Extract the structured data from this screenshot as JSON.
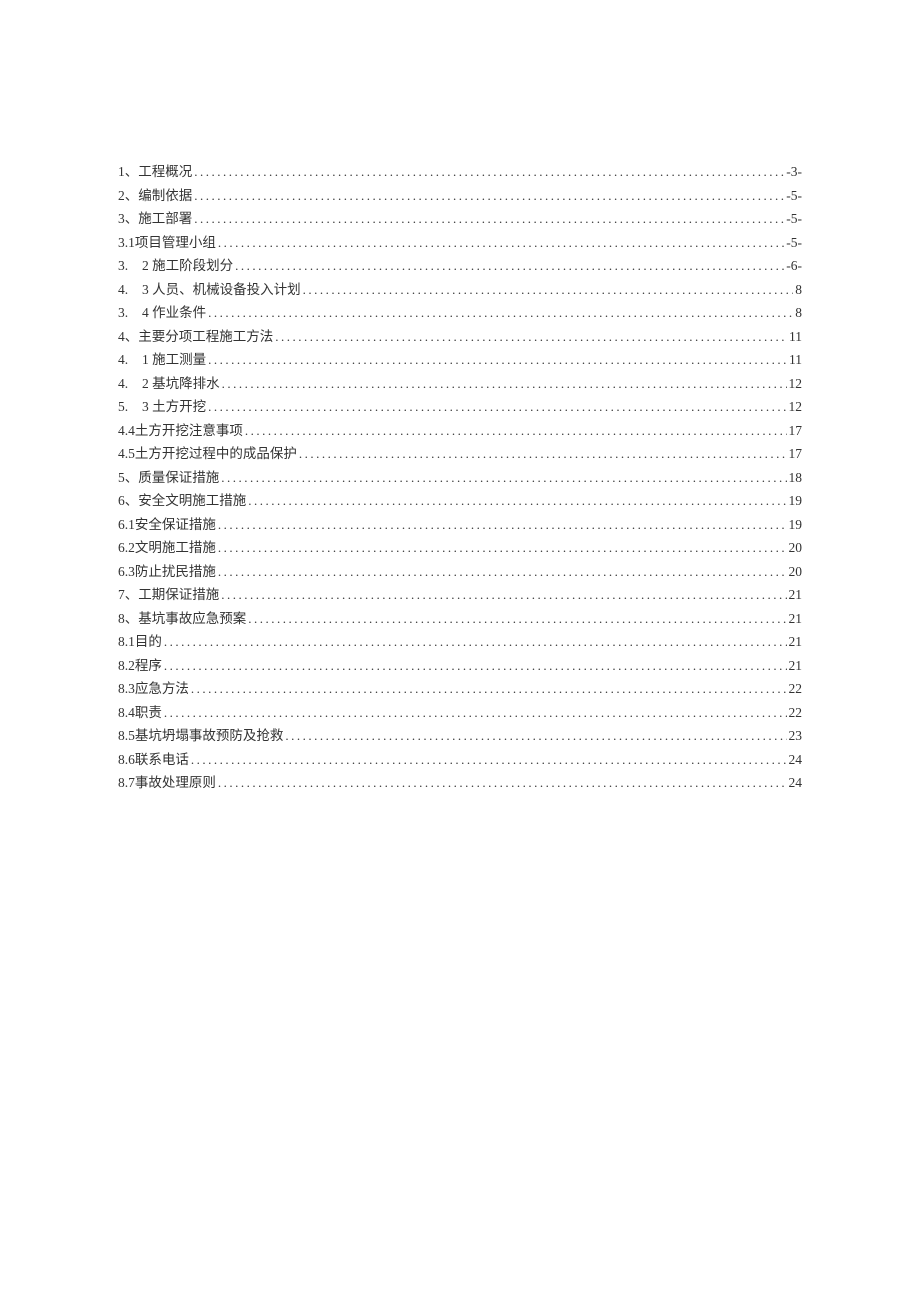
{
  "toc": [
    {
      "prefix": "1、",
      "title": "工程概况",
      "page": "-3-",
      "spaced": false
    },
    {
      "prefix": "2、",
      "title": "编制依据",
      "page": "-5-",
      "spaced": false
    },
    {
      "prefix": "3、",
      "title": "施工部署",
      "page": "-5-",
      "spaced": false
    },
    {
      "prefix": "3.1 ",
      "title": "项目管理小组",
      "page": "-5-",
      "spaced": false
    },
    {
      "prefix": "3.",
      "title": "2 施工阶段划分",
      "page": "-6-",
      "spaced": true
    },
    {
      "prefix": "4.",
      "title": "3 人员、机械设备投入计划",
      "page": "8",
      "spaced": true
    },
    {
      "prefix": "3.",
      "title": "4 作业条件",
      "page": "8",
      "spaced": true
    },
    {
      "prefix": "4、",
      "title": "主要分项工程施工方法",
      "page": "11",
      "spaced": false
    },
    {
      "prefix": "4.",
      "title": "1 施工测量",
      "page": "11",
      "spaced": true
    },
    {
      "prefix": "4.",
      "title": "2 基坑降排水",
      "page": "12",
      "spaced": true
    },
    {
      "prefix": "5.",
      "title": "3 土方开挖",
      "page": "12",
      "spaced": true
    },
    {
      "prefix": "4.4 ",
      "title": "土方开挖注意事项",
      "page": "17",
      "spaced": false
    },
    {
      "prefix": "4.5 ",
      "title": "土方开挖过程中的成品保护",
      "page": "17",
      "spaced": false
    },
    {
      "prefix": "5、",
      "title": "质量保证措施",
      "page": "18",
      "spaced": false
    },
    {
      "prefix": "6、",
      "title": "安全文明施工措施",
      "page": "19",
      "spaced": false
    },
    {
      "prefix": "6.1 ",
      "title": "安全保证措施",
      "page": "19",
      "spaced": false
    },
    {
      "prefix": "6.2 ",
      "title": "文明施工措施",
      "page": "20",
      "spaced": false
    },
    {
      "prefix": "6.3 ",
      "title": "防止扰民措施",
      "page": "20",
      "spaced": false
    },
    {
      "prefix": "7、",
      "title": "工期保证措施",
      "page": "21",
      "spaced": false
    },
    {
      "prefix": "8、",
      "title": "基坑事故应急预案",
      "page": "21",
      "spaced": false
    },
    {
      "prefix": "8.1 ",
      "title": "目的",
      "page": "21",
      "spaced": false
    },
    {
      "prefix": "8.2 ",
      "title": "程序",
      "page": "21",
      "spaced": false
    },
    {
      "prefix": "8.3 ",
      "title": "应急方法",
      "page": "22",
      "spaced": false
    },
    {
      "prefix": "8.4 ",
      "title": "职责",
      "page": "22",
      "spaced": false
    },
    {
      "prefix": "8.5 ",
      "title": "基坑坍塌事故预防及抢救",
      "page": "23",
      "spaced": false
    },
    {
      "prefix": "8.6 ",
      "title": "联系电话",
      "page": "24",
      "spaced": false
    },
    {
      "prefix": "8.7 ",
      "title": "事故处理原则",
      "page": "24",
      "spaced": false
    }
  ]
}
